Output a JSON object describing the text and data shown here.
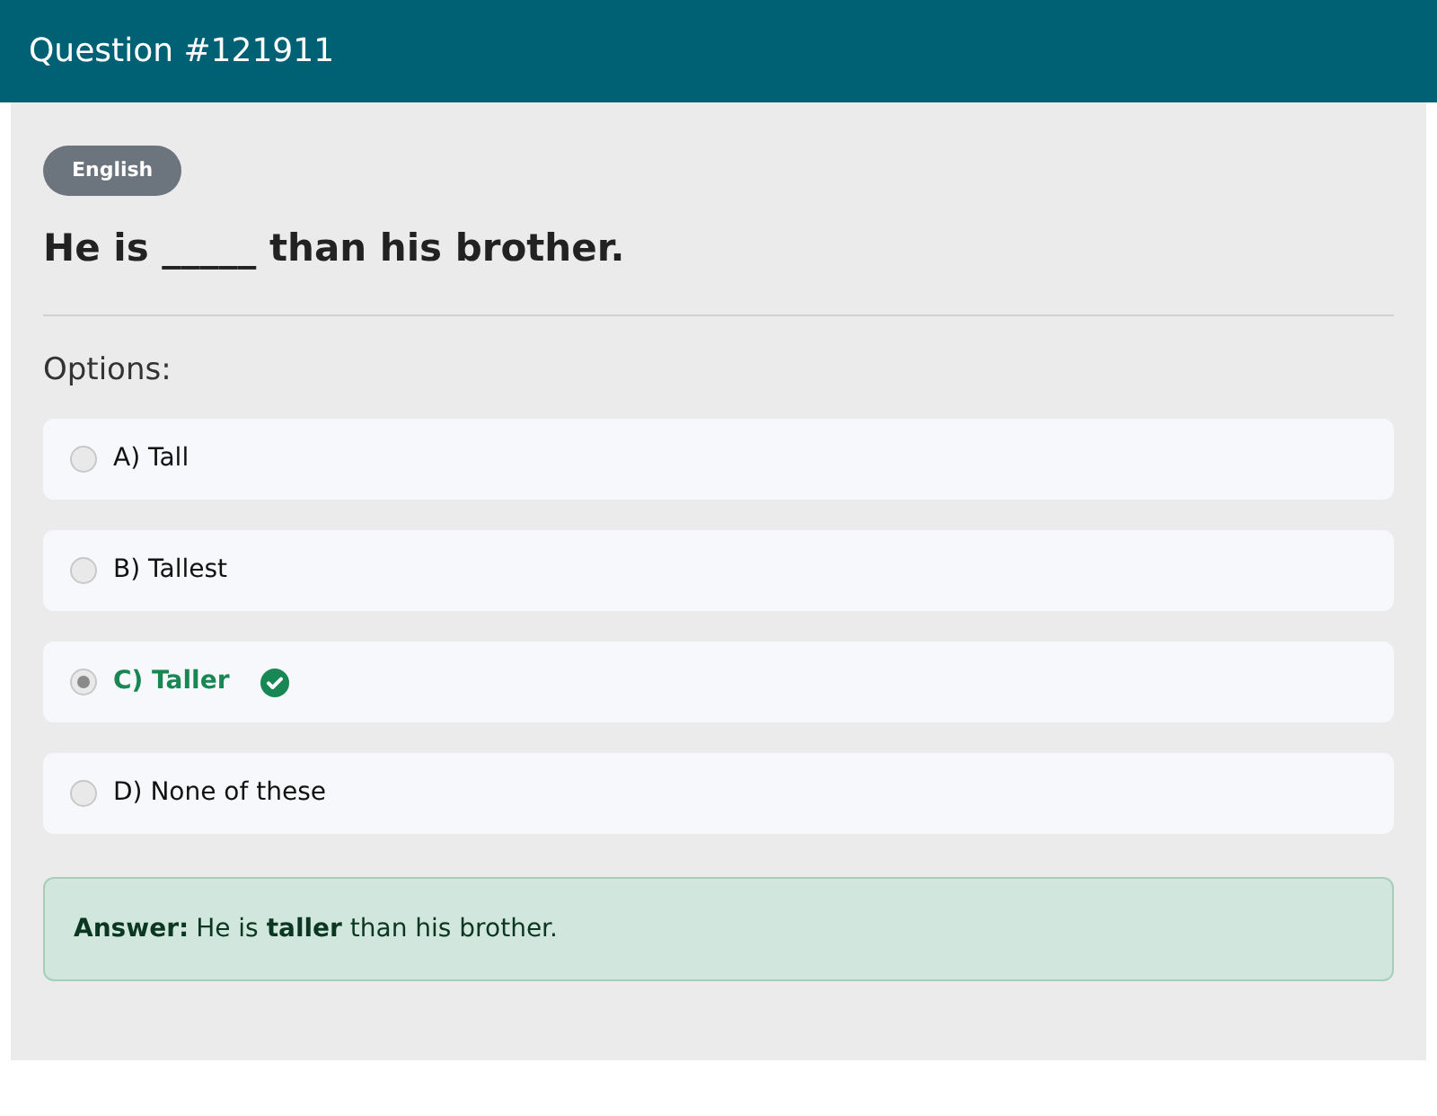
{
  "header": {
    "title": "Question #121911"
  },
  "question": {
    "category": "English",
    "text": "He is _____ than his brother.",
    "options_label": "Options:",
    "options": [
      {
        "label": "A) Tall",
        "selected": false,
        "correct": false
      },
      {
        "label": "B) Tallest",
        "selected": false,
        "correct": false
      },
      {
        "label": "C) Taller",
        "selected": true,
        "correct": true
      },
      {
        "label": "D) None of these",
        "selected": false,
        "correct": false
      }
    ]
  },
  "answer": {
    "label": "Answer:",
    "text": "He is **taller** than his brother."
  }
}
